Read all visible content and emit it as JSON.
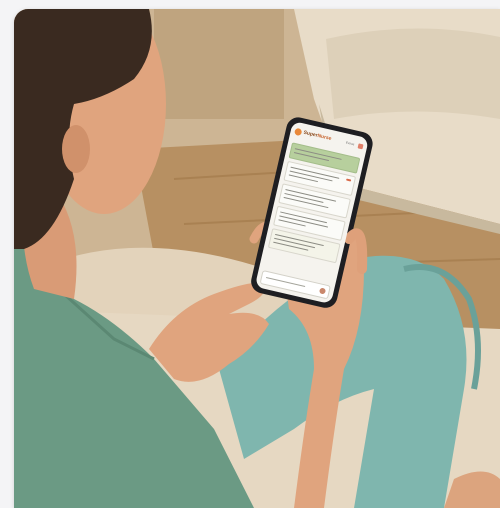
{
  "photo": {
    "subject": "",
    "colors": {
      "background_page": "#f4f4f6",
      "wall": "#cdb594",
      "floor": "#b79062",
      "sofa": "#e8dcc8",
      "scrubs": "#6b9a84",
      "pants": "#7fb6ae",
      "skin": "#e0a47e",
      "hair": "#3a2a20",
      "phone_body": "#1e1e22"
    }
  },
  "phone_app": {
    "brand_prefix": "Super",
    "brand_suffix": "Nurse",
    "header_action": "Extras",
    "messages": [
      {
        "kind": "highlight"
      },
      {
        "kind": "normal"
      },
      {
        "kind": "normal"
      },
      {
        "kind": "normal"
      },
      {
        "kind": "tinted"
      },
      {
        "kind": "normal"
      }
    ]
  }
}
